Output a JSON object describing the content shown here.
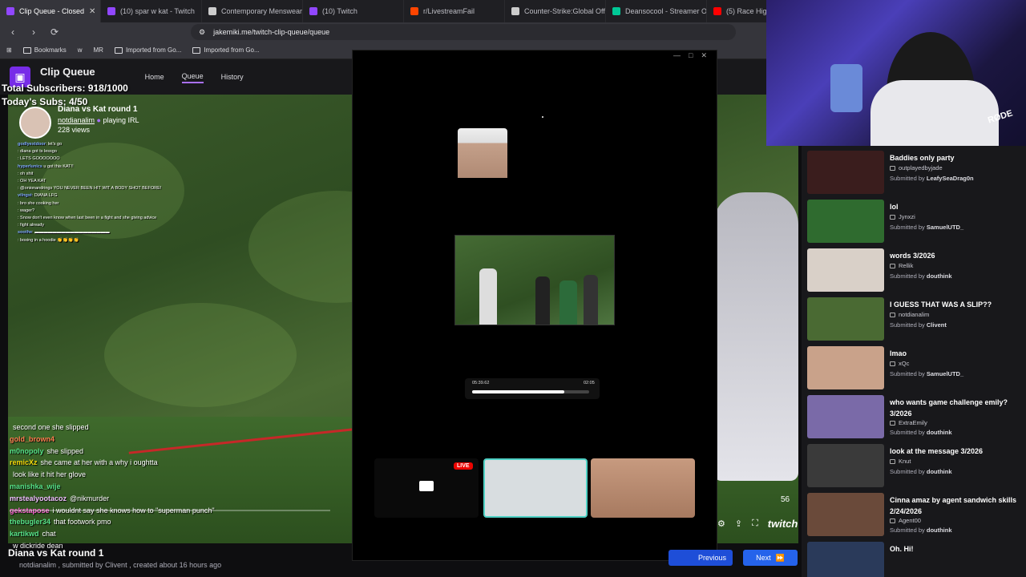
{
  "browser": {
    "tabs": [
      {
        "label": "Clip Queue - Closed",
        "color": "#9147ff",
        "active": true
      },
      {
        "label": "(10) spar w kat - Twitch",
        "color": "#9147ff"
      },
      {
        "label": "Contemporary Menswear",
        "color": "#cccccc"
      },
      {
        "label": "(10) Twitch",
        "color": "#9147ff"
      },
      {
        "label": "r/LivestreamFail",
        "color": "#ff4500"
      },
      {
        "label": "Counter-Strike:Global Offe",
        "color": "#cccccc"
      },
      {
        "label": "Deansocool - Streamer Ov",
        "color": "#00c896"
      },
      {
        "label": "(5) Race High",
        "color": "#ff0000"
      }
    ],
    "url": "jakemiki.me/twitch-clip-queue/queue",
    "bookmarks": [
      "Bookmarks",
      "w",
      "MR",
      "Imported from Go...",
      "Imported from Go..."
    ]
  },
  "app": {
    "title": "Clip Queue",
    "nav": [
      "Home",
      "Queue",
      "History"
    ]
  },
  "overlay": {
    "total_subs": "Total Subscribers: 918/1000",
    "today_subs": "Today's Subs: 4/50"
  },
  "clip": {
    "title": "Diana vs Kat round 1",
    "streamer": "notdianalim",
    "playing": "playing IRL",
    "views": "228 views",
    "bottom_title": "Diana vs Kat round 1",
    "bottom_meta": "notdianalim , submitted by Clivent , created about 16 hours ago",
    "counter": "56",
    "brand": "twitch",
    "progress_pct": 100
  },
  "small_chat": [
    {
      "user": "godlyextdoor",
      "msg": ": let's go"
    },
    {
      "user": "",
      "msg": ": diana got ts lessgo"
    },
    {
      "user": "",
      "msg": ": LETS GOOOOOOO"
    },
    {
      "user": "hyperlunics",
      "msg": " u got this KAT!!"
    },
    {
      "user": "",
      "msg": ": oh shit"
    },
    {
      "user": "",
      "msg": ": OH YEA KAT"
    },
    {
      "user": "",
      "msg": ": @onionandrings YOU NEVER BEEN HIT WIT A BODY SHOT BEFORE!"
    },
    {
      "user": "vilngst",
      "msg": ": DIANA LFG"
    },
    {
      "user": "",
      "msg": ": bro she cooking her"
    },
    {
      "user": "",
      "msg": ": wager?"
    },
    {
      "user": "",
      "msg": ": Snow don't even know when last been in a fight and she giving advice"
    },
    {
      "user": "",
      "msg": ": fight already"
    },
    {
      "user": "soothe",
      "msg": ": ▬▬▬▬▬▬▬▬▬▬▬▬▬▬▬▬▬"
    },
    {
      "user": "",
      "msg": ": boxing in a hoodie 👏👏👏👏"
    }
  ],
  "big_chat": [
    {
      "user": "",
      "msg": "second one she slipped",
      "color": "#6b8cff"
    },
    {
      "user": "gold_brown4",
      "msg": "",
      "color": "#ff7f50"
    },
    {
      "user": "m0nopoly",
      "msg": "she slipped",
      "color": "#57e389"
    },
    {
      "user": "remicXz",
      "msg": "she came at her with a why i oughtta",
      "color": "#f5d90a"
    },
    {
      "user": "",
      "msg": "look like it hit her glove",
      "color": "#57e389"
    },
    {
      "user": "manishka_wije",
      "msg": "",
      "color": "#57e389"
    },
    {
      "user": "mrstealyootacoz",
      "msg": "@nikmurder",
      "color": "#f0c0ff"
    },
    {
      "user": "gekstapose",
      "msg": "i wouldnt say she knows how to \"superman punch\"",
      "color": "#ff6bd6"
    },
    {
      "user": "thebugler34",
      "msg": "that footwork pmo",
      "color": "#57e389"
    },
    {
      "user": "kartikwd",
      "msg": "chat",
      "color": "#57e389"
    },
    {
      "user": "",
      "msg": "w dickride dean",
      "color": "#6b8cff"
    }
  ],
  "modal": {
    "time_elapsed": "05:39.62",
    "time_total": "02:05",
    "progress": 0.79,
    "live_label": "LIVE"
  },
  "buttons": {
    "previous": "Previous",
    "next": "Next"
  },
  "webcam_text": "RØDE",
  "queue": [
    {
      "title": "Baddies only party",
      "channel": "outplayedbyjade",
      "submitted": "LeafySeaDrag0n",
      "thumb": "#3a1d1d"
    },
    {
      "title": "lol",
      "channel": "Jynxzi",
      "submitted": "SamuelUTD_",
      "thumb": "#2f6b2f"
    },
    {
      "title": "words 3/2026",
      "channel": "Rellik",
      "submitted": "douthink",
      "thumb": "#d9d0c8"
    },
    {
      "title": "I GUESS THAT WAS A SLIP??",
      "channel": "notdianalim",
      "submitted": "Clivent",
      "thumb": "#4a6a33"
    },
    {
      "title": "lmao",
      "channel": "xQc",
      "submitted": "SamuelUTD_",
      "thumb": "#c9a28a"
    },
    {
      "title": "who wants game challenge emily? 3/2026",
      "channel": "ExtraEmily",
      "submitted": "douthink",
      "thumb": "#7a6aa8"
    },
    {
      "title": "look at the message 3/2026",
      "channel": "Knut",
      "submitted": "douthink",
      "thumb": "#3a3a3a"
    },
    {
      "title": "Cinna amaz by agent sandwich skills 2/24/2026",
      "channel": "Agent00",
      "submitted": "douthink",
      "thumb": "#6a4a3a"
    },
    {
      "title": "Oh. Hi!",
      "channel": "",
      "submitted": "",
      "thumb": "#2a3a5a"
    }
  ],
  "labels": {
    "submitted_by": "Submitted by"
  }
}
